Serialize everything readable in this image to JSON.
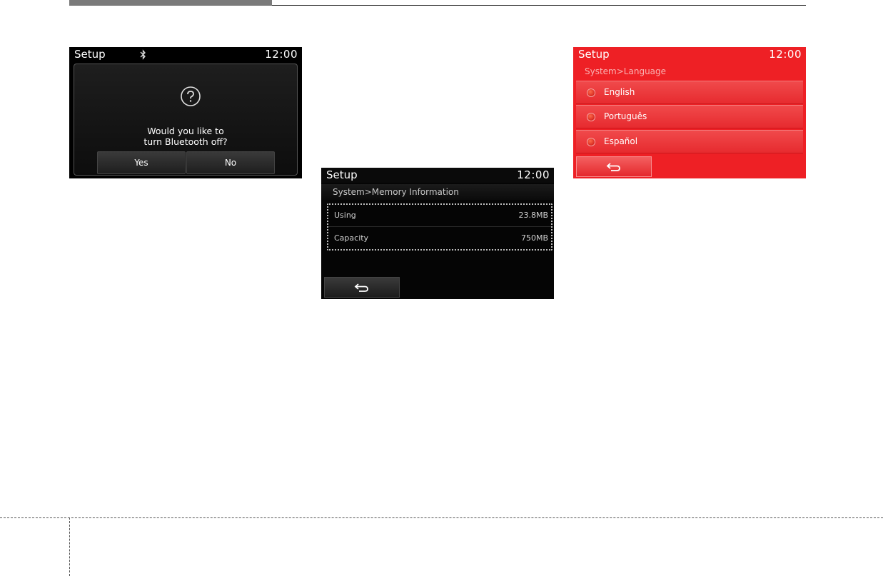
{
  "bt_dialog": {
    "title": "Setup",
    "clock": "12:00",
    "status_icon": "bluetooth-icon",
    "dialog_icon": "question-icon",
    "message": "Would you like to\nturn Bluetooth off?",
    "yes_label": "Yes",
    "no_label": "No"
  },
  "memory": {
    "title": "Setup",
    "clock": "12:00",
    "breadcrumb": "System>Memory Information",
    "rows": [
      {
        "label": "Using",
        "value": "23.8MB"
      },
      {
        "label": "Capacity",
        "value": "750MB"
      }
    ],
    "back_icon": "back-arrow-icon"
  },
  "language": {
    "title": "Setup",
    "clock": "12:00",
    "breadcrumb": "System>Language",
    "options": [
      {
        "label": "English"
      },
      {
        "label": "Português"
      },
      {
        "label": "Español"
      }
    ],
    "back_icon": "back-arrow-icon",
    "accent_color": "#ee2025"
  }
}
